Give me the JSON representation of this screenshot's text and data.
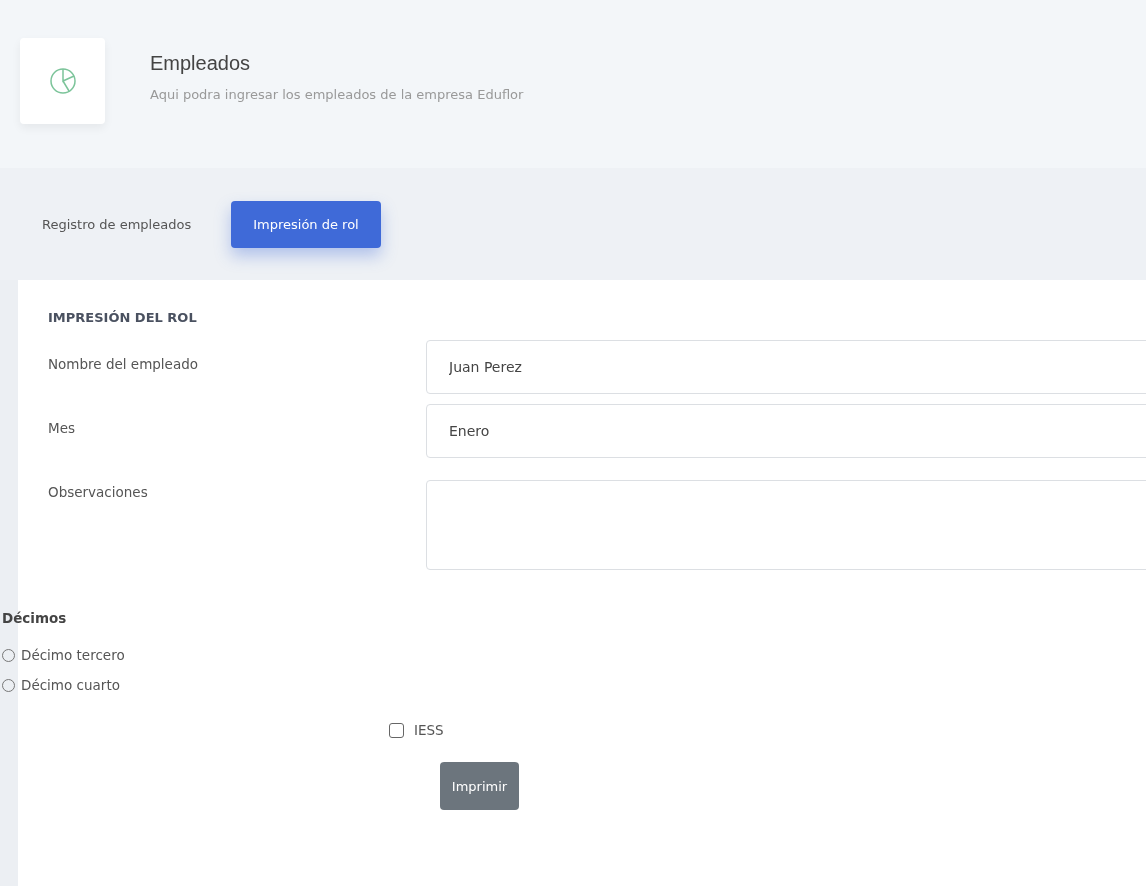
{
  "header": {
    "title": "Empleados",
    "subtitle": "Aqui podra ingresar los empleados de la empresa Eduflor"
  },
  "tabs": [
    {
      "label": "Registro de empleados",
      "selected": false
    },
    {
      "label": "Impresión de rol",
      "selected": true
    }
  ],
  "form": {
    "heading": "IMPRESIÓN DEL ROL",
    "fields": [
      {
        "kind": "input",
        "label": "Nombre del empleado",
        "value": "Juan Perez"
      },
      {
        "kind": "input",
        "label": "Mes",
        "value": "Enero"
      },
      {
        "kind": "textarea",
        "label": "Observaciones"
      }
    ],
    "radio_group": {
      "title": "Décimos",
      "options": [
        {
          "label": "Décimo tercero",
          "selected": false
        },
        {
          "label": "Décimo cuarto",
          "selected": false
        }
      ]
    },
    "checkbox": {
      "label": "IESS",
      "checked": false
    },
    "submit": "Imprimir"
  }
}
